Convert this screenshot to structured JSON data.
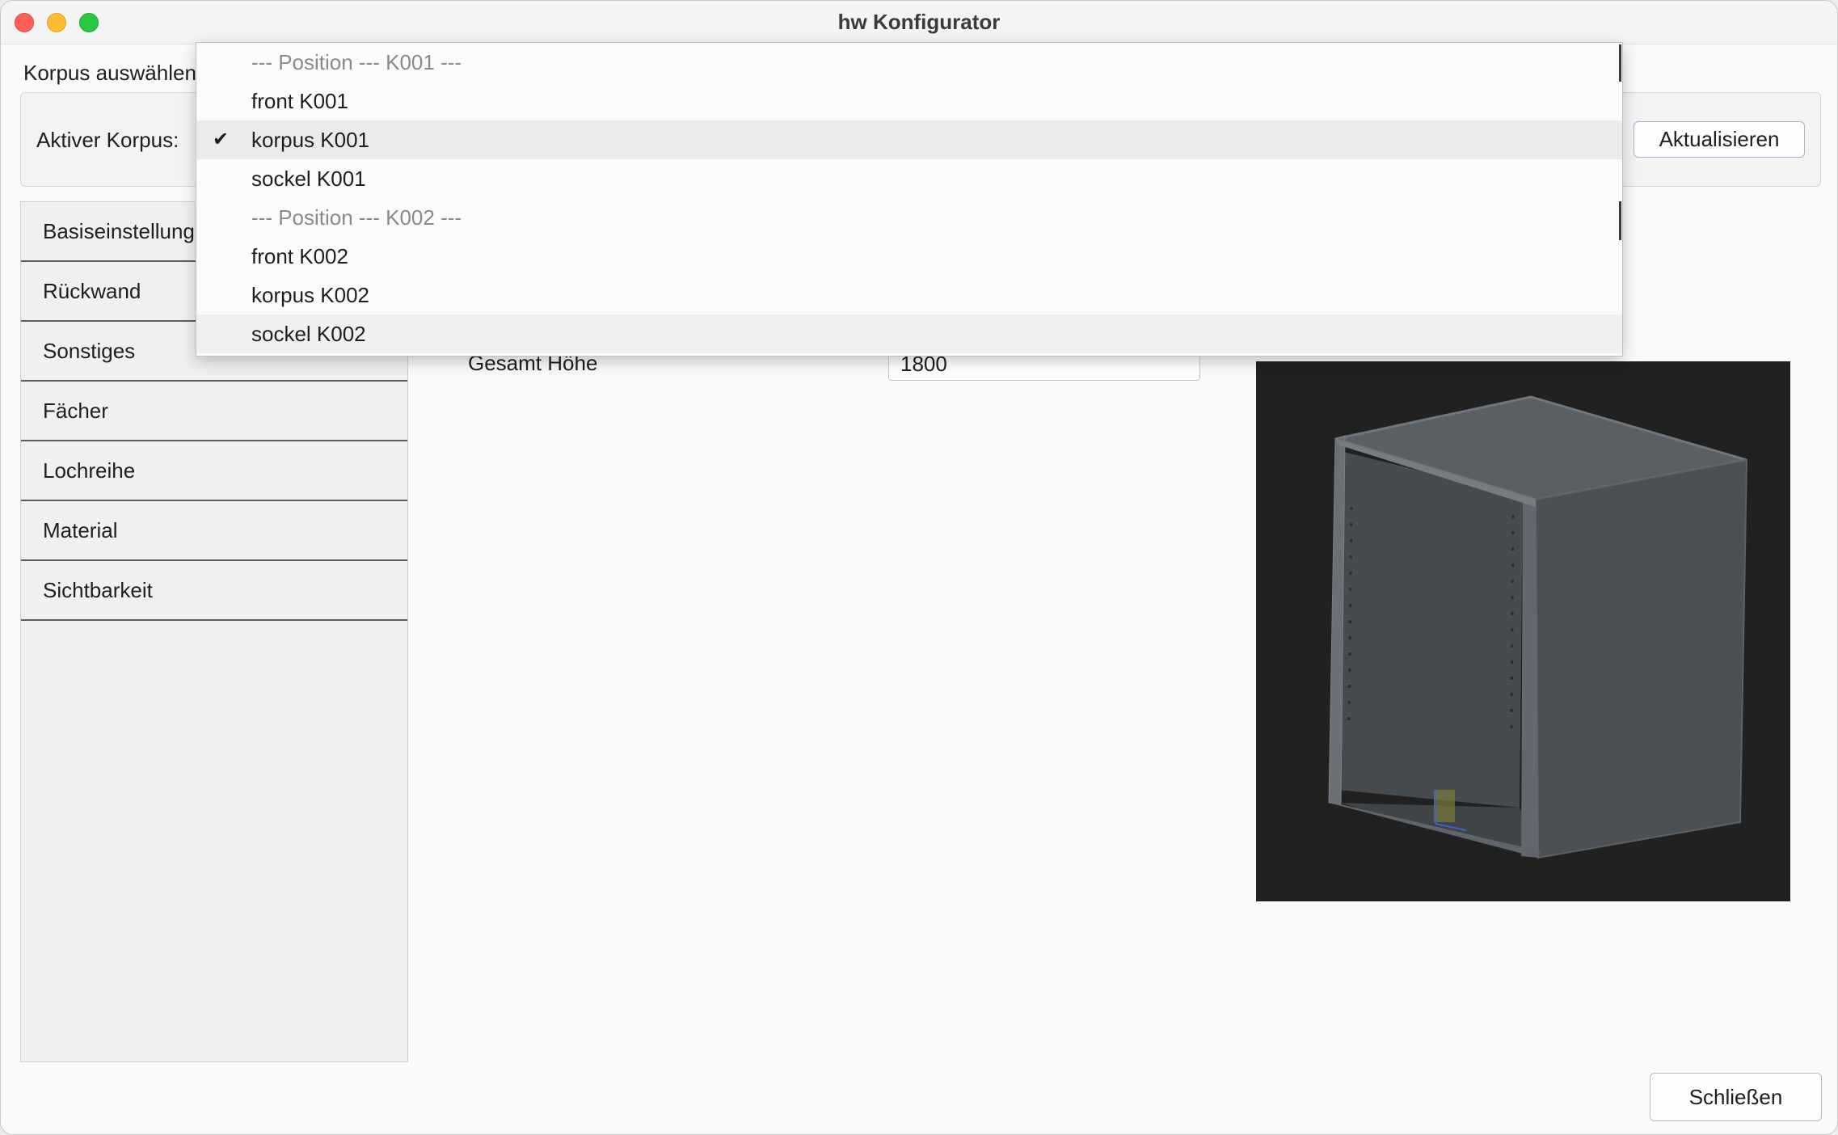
{
  "window": {
    "title": "hw Konfigurator"
  },
  "korpus": {
    "group_label": "Korpus auswählen",
    "active_label": "Aktiver Korpus:",
    "refresh_button": "Aktualisieren"
  },
  "dropdown": {
    "items": [
      {
        "label": "--- Position --- K001 ---",
        "type": "header"
      },
      {
        "label": "front K001",
        "type": "option"
      },
      {
        "label": "korpus K001",
        "type": "option",
        "selected": true
      },
      {
        "label": "sockel K001",
        "type": "option"
      },
      {
        "label": "--- Position --- K002 ---",
        "type": "header"
      },
      {
        "label": "front K002",
        "type": "option"
      },
      {
        "label": "korpus K002",
        "type": "option"
      },
      {
        "label": "sockel K002",
        "type": "option"
      }
    ]
  },
  "sidebar": {
    "tabs": [
      {
        "label": "Basiseinstellungen"
      },
      {
        "label": "Rückwand"
      },
      {
        "label": "Sonstiges"
      },
      {
        "label": "Fächer"
      },
      {
        "label": "Lochreihe"
      },
      {
        "label": "Material"
      },
      {
        "label": "Sichtbarkeit"
      }
    ]
  },
  "content": {
    "height_label": "Gesamt Höhe",
    "height_value": "1800"
  },
  "footer": {
    "close_button": "Schließen"
  },
  "colors": {
    "viewport_bg": "#212121",
    "cabinet": "#4b5054",
    "selected_row": "#ebebeb"
  }
}
